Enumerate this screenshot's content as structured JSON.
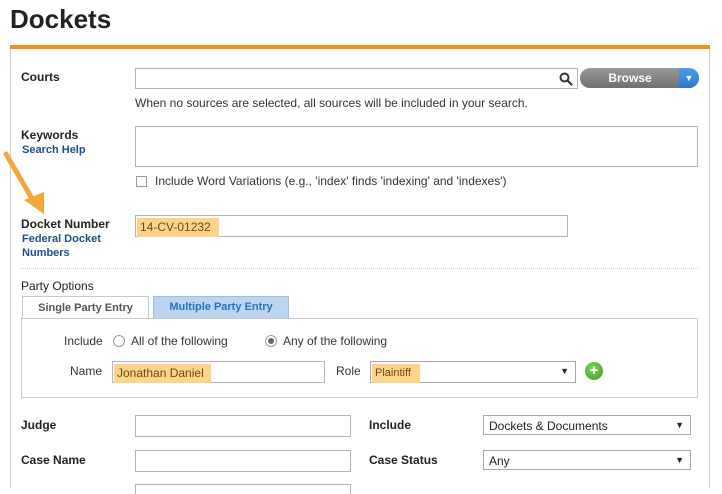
{
  "page": {
    "title": "Dockets"
  },
  "courts": {
    "label": "Courts",
    "input_value": "",
    "browse_label": "Browse",
    "hint": "When no sources are selected, all sources will be included in your search."
  },
  "keywords": {
    "label": "Keywords",
    "help_link": "Search Help",
    "value": "",
    "variations_label": "Include Word Variations (e.g., 'index' finds 'indexing' and 'indexes')"
  },
  "docket_number": {
    "label": "Docket Number",
    "link_line1": "Federal Docket",
    "link_line2": "Numbers",
    "value": "14-CV-01232"
  },
  "party_options": {
    "label": "Party Options",
    "tabs": [
      {
        "label": "Single Party Entry",
        "active": true
      },
      {
        "label": "Multiple Party Entry",
        "active": false
      }
    ],
    "include_label": "Include",
    "radio_all": "All of the following",
    "radio_any": "Any of the following",
    "selected_radio": "any",
    "name_label": "Name",
    "name_value": "Jonathan Daniel",
    "role_label": "Role",
    "role_value": "Plaintiff",
    "add_symbol": "+"
  },
  "judge": {
    "label": "Judge",
    "value": ""
  },
  "include_select": {
    "label": "Include",
    "value": "Dockets & Documents"
  },
  "case_name": {
    "label": "Case Name",
    "value": ""
  },
  "case_status": {
    "label": "Case Status",
    "value": "Any"
  },
  "colors": {
    "accent": "#f28c1e",
    "link": "#1f4f8a",
    "highlight": "#fcd58a",
    "browse_caret": "#2a78cc",
    "add_button": "#4fae2a"
  },
  "icons": {
    "search": "search-icon",
    "caret": "chevron-down-icon",
    "add": "plus-icon",
    "annotation": "arrow-icon"
  }
}
